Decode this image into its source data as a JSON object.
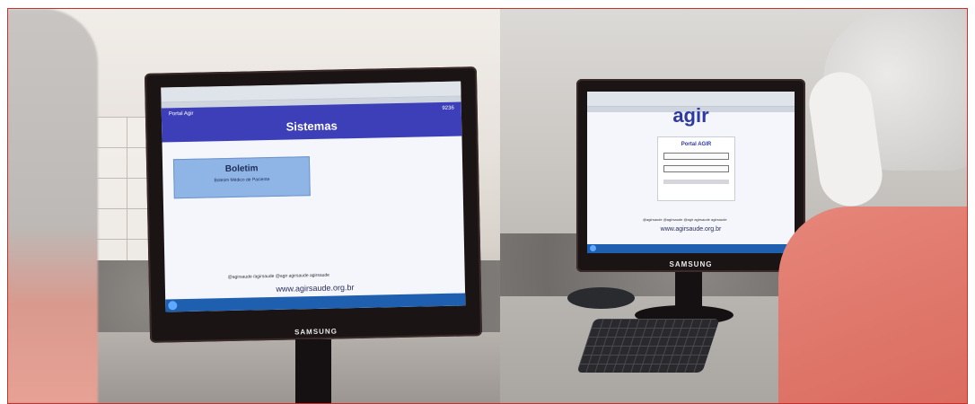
{
  "left_screen": {
    "portal_label": "Portal Agir",
    "code": "9236",
    "title": "Sistemas",
    "card_title": "Boletim",
    "card_subtitle": "Boletim Médico de Paciente",
    "social": "@agirsaude   /agirsaude   @agir   agirsaude   agirsaude",
    "website": "www.agirsaude.org.br"
  },
  "right_screen": {
    "logo": "agir",
    "login_title": "Portal AGIR",
    "social": "@agirsaude  @agirsaude  @agir  agirsaude  agirsaude",
    "website": "www.agirsaude.org.br"
  },
  "monitor_brand_left": "SAMSUNG",
  "monitor_brand_right": "SAMSUNG"
}
